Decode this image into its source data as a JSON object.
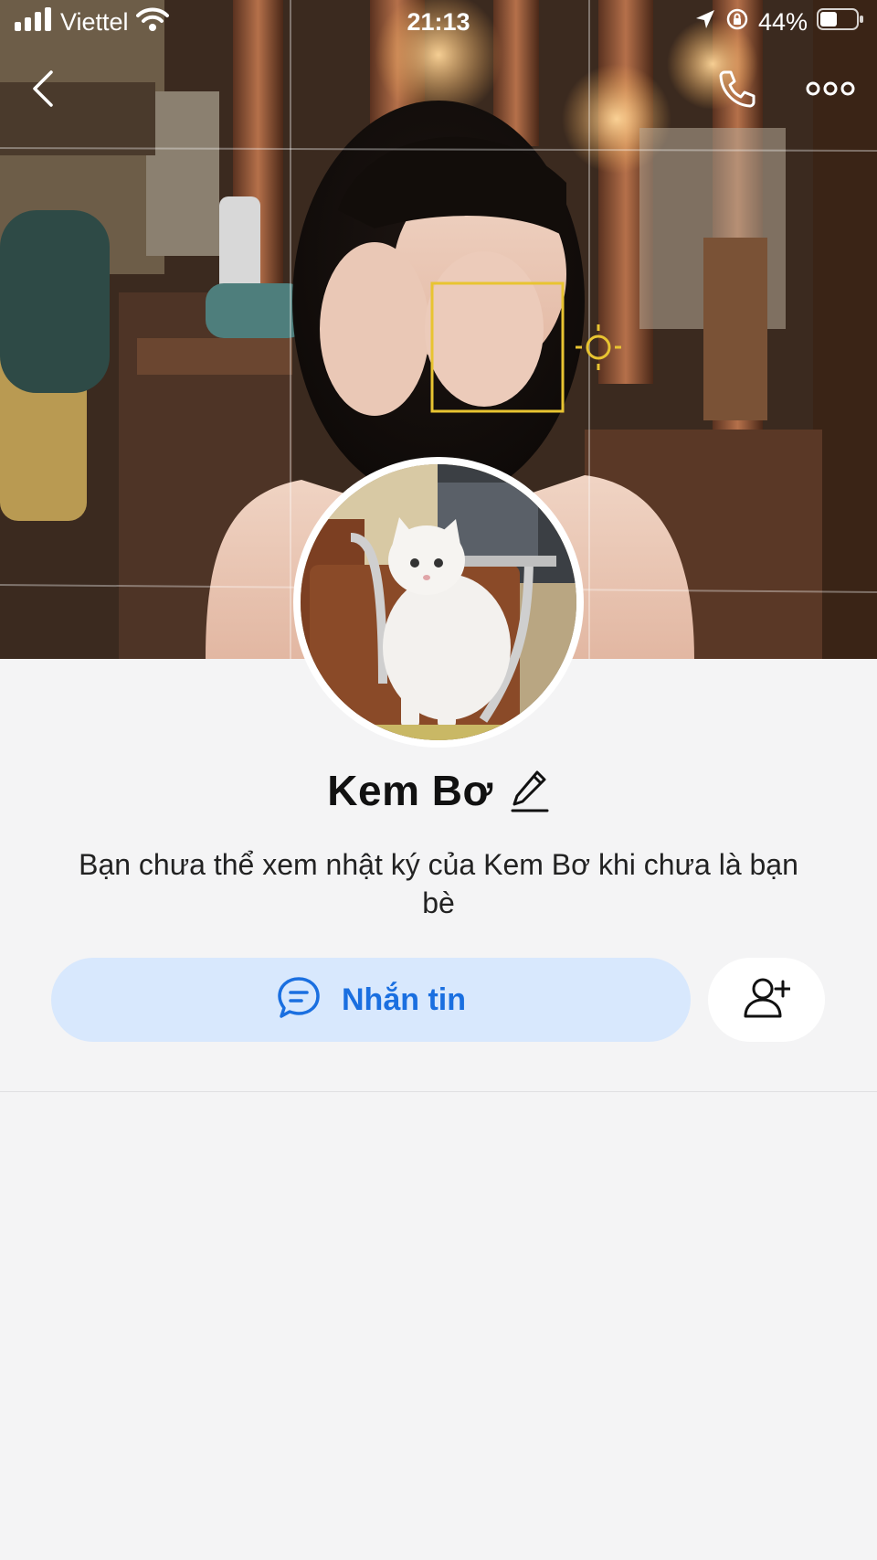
{
  "status_bar": {
    "carrier": "Viettel",
    "time": "21:13",
    "battery": "44%"
  },
  "nav": {
    "back_icon": "chevron-left-icon",
    "call_icon": "phone-icon",
    "more_icon": "ellipsis-icon"
  },
  "profile": {
    "name": "Kem Bơ",
    "privacy_note": "Bạn chưa thể xem nhật ký của Kem Bơ khi chưa là bạn bè"
  },
  "actions": {
    "message_label": "Nhắn tin",
    "message_icon": "chat-bubble-icon",
    "add_friend_icon": "add-user-icon"
  },
  "colors": {
    "accent": "#1a6fe0",
    "message_button_bg": "#d8e8fd",
    "page_bg": "#f4f4f5"
  }
}
